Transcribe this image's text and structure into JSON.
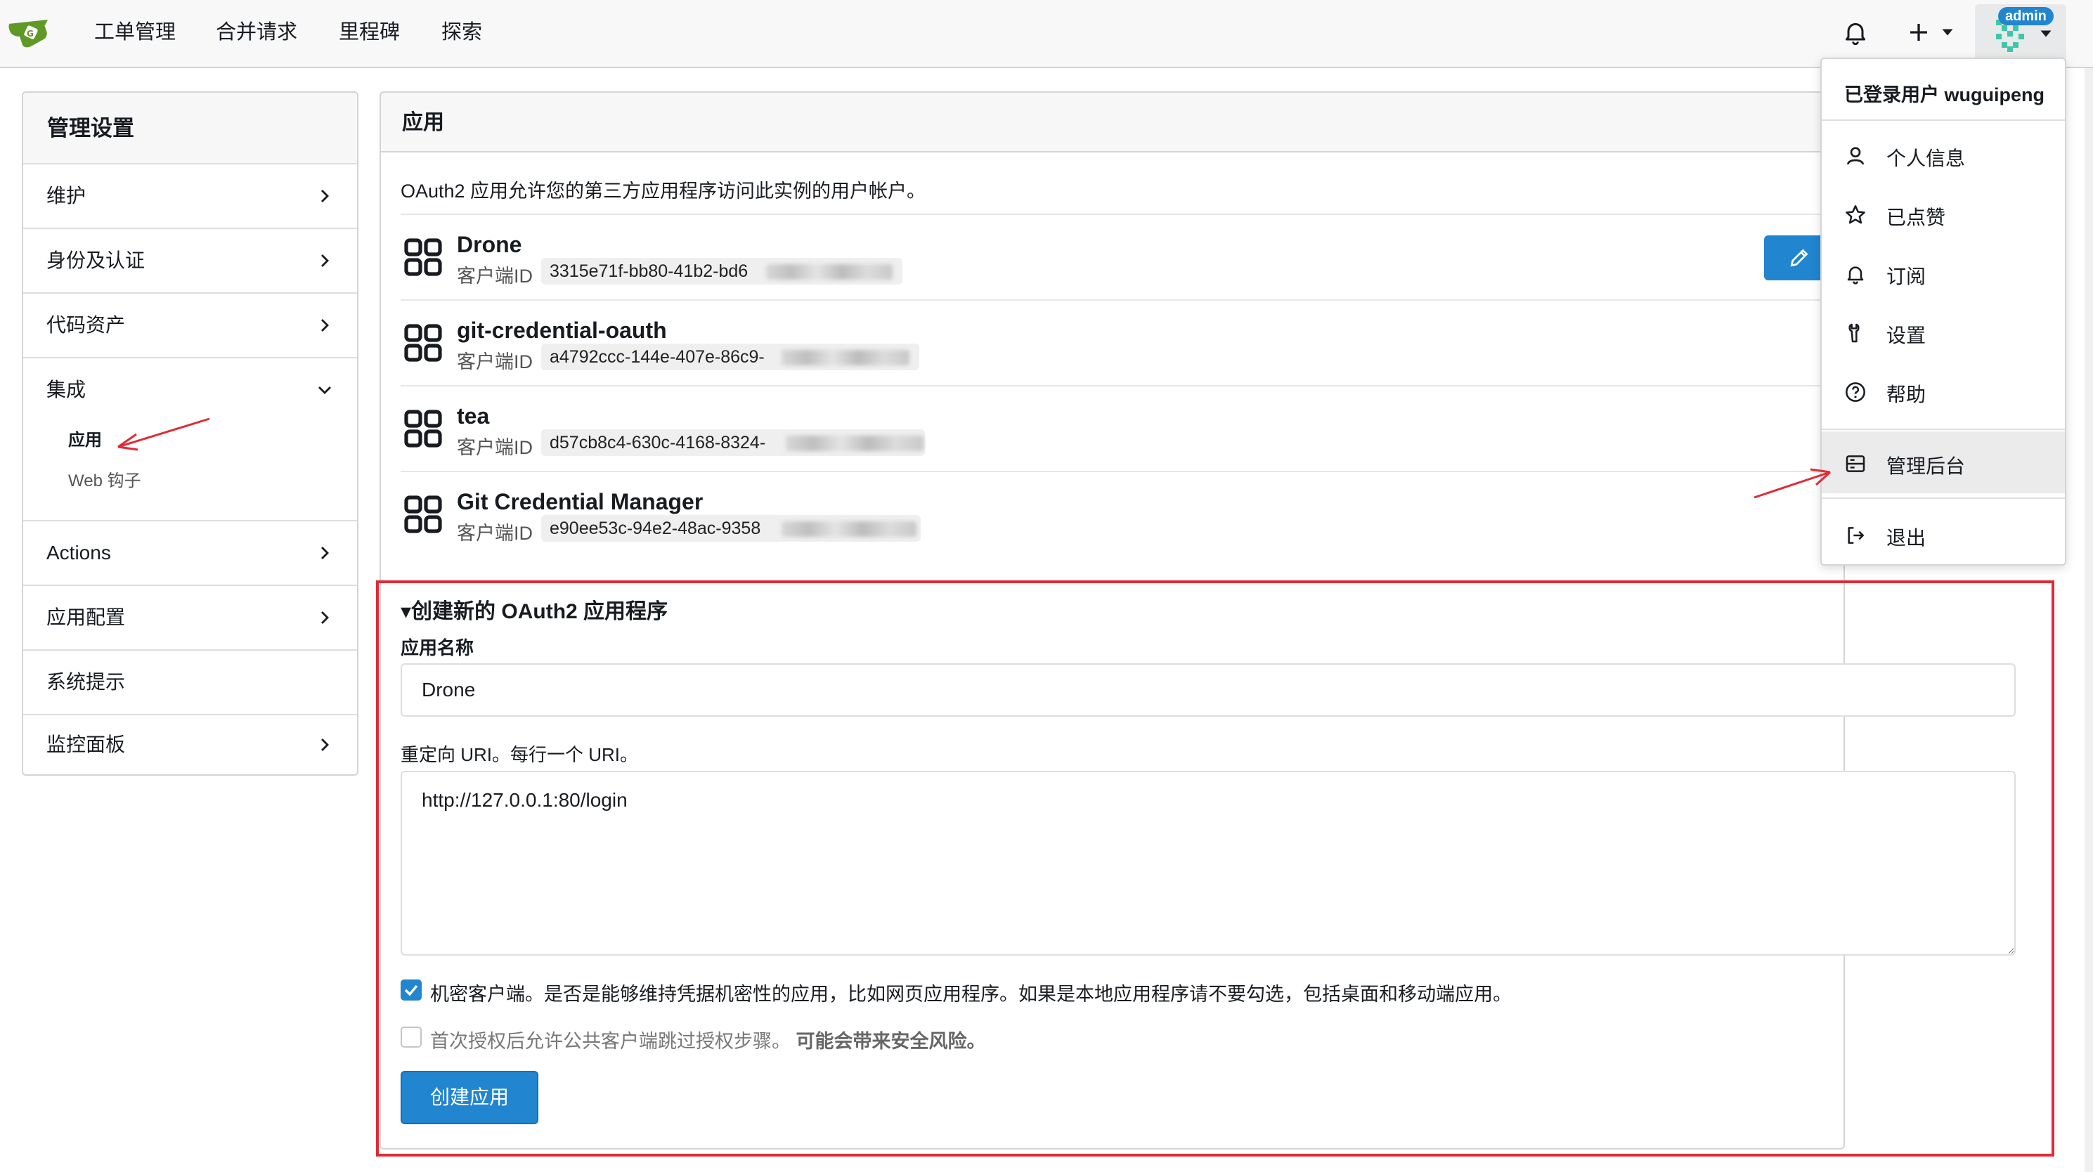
{
  "nav": {
    "items": [
      "工单管理",
      "合并请求",
      "里程碑",
      "探索"
    ],
    "badge": "admin"
  },
  "sidebar": {
    "title": "管理设置",
    "items": [
      {
        "label": "维护",
        "chevron": "chevron-right"
      },
      {
        "label": "身份及认证",
        "chevron": "chevron-right"
      },
      {
        "label": "代码资产",
        "chevron": "chevron-right"
      },
      {
        "label": "集成",
        "chevron": "chevron-down",
        "expanded": true,
        "children": [
          "应用",
          "Web 钩子"
        ]
      },
      {
        "label": "Actions",
        "chevron": "chevron-right"
      },
      {
        "label": "应用配置",
        "chevron": "chevron-right"
      },
      {
        "label": "系统提示",
        "chevron": ""
      },
      {
        "label": "监控面板",
        "chevron": "chevron-right"
      }
    ]
  },
  "main": {
    "title": "应用",
    "description": "OAuth2 应用允许您的第三方应用程序访问此实例的用户帐户。",
    "client_id_label": "客户端ID",
    "apps": [
      {
        "name": "Drone",
        "client_id": "3315e71f-bb80-41b2-bd6"
      },
      {
        "name": "git-credential-oauth",
        "client_id": "a4792ccc-144e-407e-86c9-"
      },
      {
        "name": "tea",
        "client_id": "d57cb8c4-630c-4168-8324-"
      },
      {
        "name": "Git Credential Manager",
        "client_id": "e90ee53c-94e2-48ac-9358"
      }
    ]
  },
  "form": {
    "title": "▾创建新的 OAuth2 应用程序",
    "name_label": "应用名称",
    "name_value": "Drone",
    "redirect_label": "重定向 URI。每行一个 URI。",
    "redirect_value": "http://127.0.0.1:80/login",
    "confidential_text": "机密客户端。是否是能够维持凭据机密性的应用，比如网页应用程序。如果是本地应用程序请不要勾选，包括桌面和移动端应用。",
    "confidential_checked": true,
    "skip_text": "首次授权后允许公共客户端跳过授权步骤。",
    "skip_warning": "可能会带来安全风险。",
    "skip_checked": false,
    "submit_label": "创建应用"
  },
  "dropdown": {
    "header": "已登录用户 wuguipeng",
    "items": [
      {
        "label": "个人信息",
        "icon": "person-icon"
      },
      {
        "label": "已点赞",
        "icon": "star-icon"
      },
      {
        "label": "订阅",
        "icon": "bell-icon"
      },
      {
        "label": "设置",
        "icon": "wrench-icon"
      },
      {
        "label": "帮助",
        "icon": "help-icon"
      },
      {
        "label": "管理后台",
        "icon": "server-icon",
        "active": true
      },
      {
        "label": "退出",
        "icon": "sign-out-icon"
      }
    ]
  },
  "colors": {
    "primary": "#2185d0",
    "highlight_box": "#e02b36",
    "logo_green": "#609926"
  }
}
